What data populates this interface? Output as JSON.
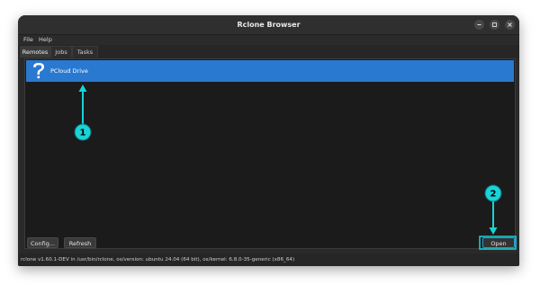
{
  "window": {
    "title": "Rclone Browser"
  },
  "menu": {
    "file": "File",
    "help": "Help"
  },
  "tabs": [
    {
      "label": "Remotes"
    },
    {
      "label": "Jobs"
    },
    {
      "label": "Tasks"
    }
  ],
  "remotes": [
    {
      "name": "PCloud Drive",
      "icon": "question-mark-icon",
      "selected": true
    }
  ],
  "buttons": {
    "config": "Config...",
    "refresh": "Refresh",
    "open": "Open"
  },
  "status": "rclone v1.60.1-DEV in /usr/bin/rclone, os/version: ubuntu 24.04 (64 bit), os/kernel: 6.8.0-35-generic (x86_64)",
  "annotations": [
    {
      "number": "1"
    },
    {
      "number": "2"
    }
  ],
  "colors": {
    "selection": "#2a79d0",
    "annotation": "#19d3d6",
    "window_bg": "#2a2a2a"
  }
}
